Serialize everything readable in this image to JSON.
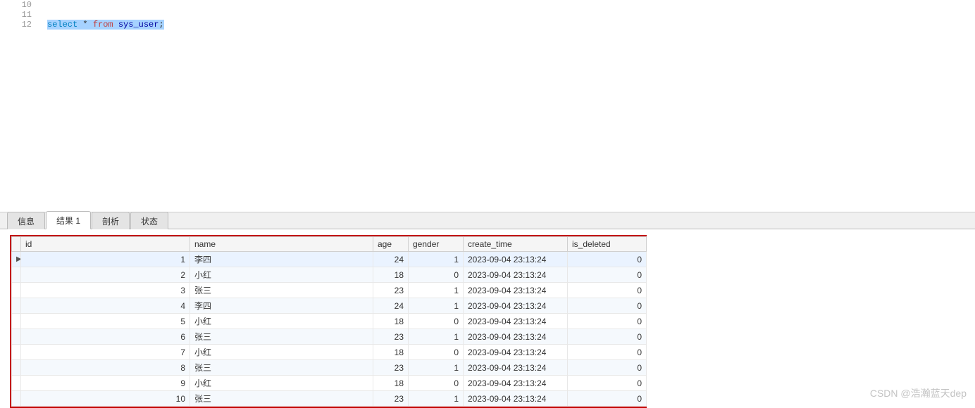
{
  "editor": {
    "lines": [
      {
        "no": "10",
        "text": ""
      },
      {
        "no": "11",
        "text": ""
      },
      {
        "no": "12",
        "text": "select * from sys_user;",
        "selected": true
      }
    ],
    "sql_tokens": {
      "select": "select",
      "star": "*",
      "from": "from",
      "table": "sys_user",
      "semi": ";"
    }
  },
  "tabs": {
    "items": [
      "信息",
      "结果 1",
      "剖析",
      "状态"
    ],
    "active_index": 1
  },
  "results": {
    "columns": [
      "id",
      "name",
      "age",
      "gender",
      "create_time",
      "is_deleted"
    ],
    "rows": [
      {
        "id": 1,
        "name": "李四",
        "age": 24,
        "gender": 1,
        "create_time": "2023-09-04 23:13:24",
        "is_deleted": 0
      },
      {
        "id": 2,
        "name": "小红",
        "age": 18,
        "gender": 0,
        "create_time": "2023-09-04 23:13:24",
        "is_deleted": 0
      },
      {
        "id": 3,
        "name": "张三",
        "age": 23,
        "gender": 1,
        "create_time": "2023-09-04 23:13:24",
        "is_deleted": 0
      },
      {
        "id": 4,
        "name": "李四",
        "age": 24,
        "gender": 1,
        "create_time": "2023-09-04 23:13:24",
        "is_deleted": 0
      },
      {
        "id": 5,
        "name": "小红",
        "age": 18,
        "gender": 0,
        "create_time": "2023-09-04 23:13:24",
        "is_deleted": 0
      },
      {
        "id": 6,
        "name": "张三",
        "age": 23,
        "gender": 1,
        "create_time": "2023-09-04 23:13:24",
        "is_deleted": 0
      },
      {
        "id": 7,
        "name": "小红",
        "age": 18,
        "gender": 0,
        "create_time": "2023-09-04 23:13:24",
        "is_deleted": 0
      },
      {
        "id": 8,
        "name": "张三",
        "age": 23,
        "gender": 1,
        "create_time": "2023-09-04 23:13:24",
        "is_deleted": 0
      },
      {
        "id": 9,
        "name": "小红",
        "age": 18,
        "gender": 0,
        "create_time": "2023-09-04 23:13:24",
        "is_deleted": 0
      },
      {
        "id": 10,
        "name": "张三",
        "age": 23,
        "gender": 1,
        "create_time": "2023-09-04 23:13:24",
        "is_deleted": 0
      }
    ],
    "selected_row_index": 0
  },
  "watermark": "CSDN @浩瀚蓝天dep"
}
